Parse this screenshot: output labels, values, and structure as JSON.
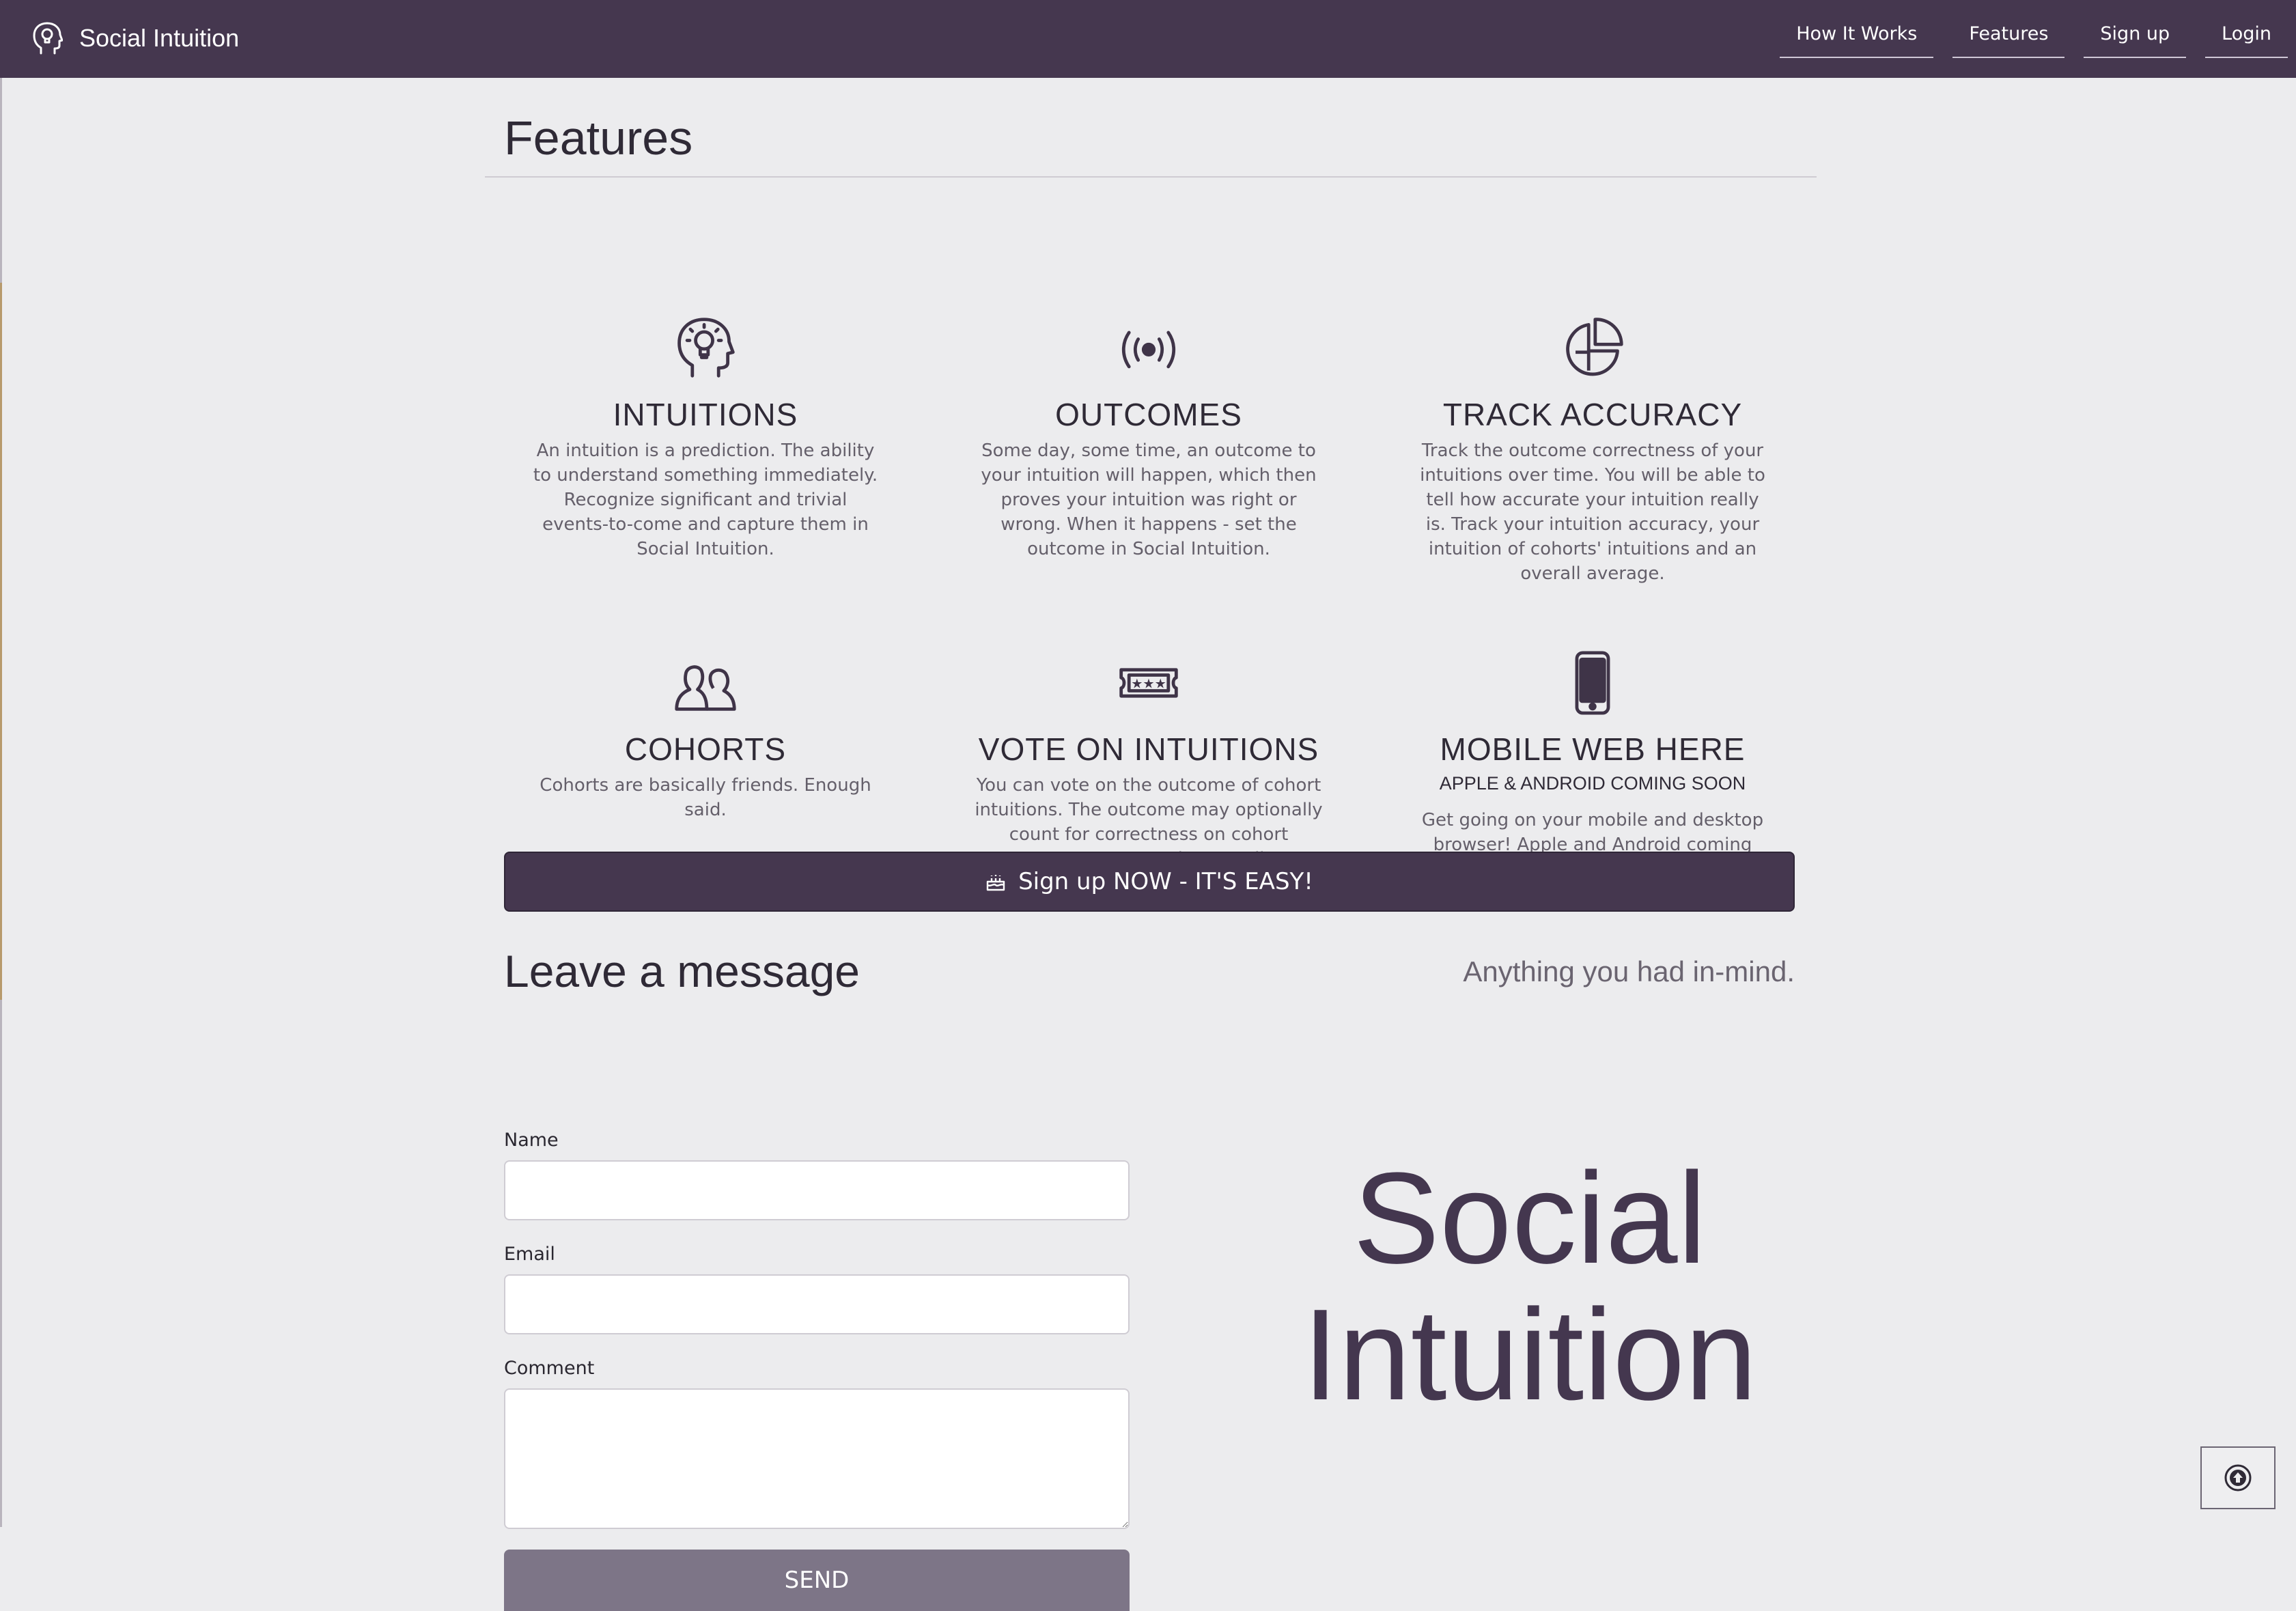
{
  "brand": {
    "name": "Social Intuition",
    "icon": "head-lightbulb-icon"
  },
  "nav": [
    {
      "label": "How It Works"
    },
    {
      "label": "Features"
    },
    {
      "label": "Sign up"
    },
    {
      "label": "Login"
    }
  ],
  "features": {
    "title": "Features",
    "items": [
      {
        "icon": "head-lightbulb-icon",
        "title": "INTUITIONS",
        "subtitle": "",
        "text": "An intuition is a prediction. The ability to understand something immediately. Recognize significant and trivial events-to-come and capture them in Social Intuition."
      },
      {
        "icon": "broadcast-icon",
        "title": "OUTCOMES",
        "subtitle": "",
        "text": "Some day, some time, an outcome to your intuition will happen, which then proves your intuition was right or wrong. When it happens - set the outcome in Social Intuition."
      },
      {
        "icon": "pie-chart-icon",
        "title": "TRACK ACCURACY",
        "subtitle": "",
        "text": "Track the outcome correctness of your intuitions over time. You will be able to tell how accurate your intuition really is. Track your intuition accuracy, your intuition of cohorts' intuitions and an overall average."
      },
      {
        "icon": "users-icon",
        "title": "COHORTS",
        "subtitle": "",
        "text": "Cohorts are basically friends. Enough said."
      },
      {
        "icon": "ticket-stars-icon",
        "title": "VOTE ON INTUITIONS",
        "subtitle": "",
        "text": "You can vote on the outcome of cohort intuitions. The outcome may optionally count for correctness on cohort accuracy. You may also contribute possible outcomes for cohort intuitions."
      },
      {
        "icon": "mobile-phone-icon",
        "title": "MOBILE WEB HERE",
        "subtitle": "APPLE & ANDROID COMING SOON",
        "text": "Get going on your mobile and desktop browser! Apple and Android coming soon."
      }
    ]
  },
  "cta": {
    "label": "Sign up NOW - IT'S EASY!",
    "icon": "birthday-cake-icon"
  },
  "message": {
    "title": "Leave a message",
    "subtitle": "Anything you had in-mind.",
    "fields": {
      "name_label": "Name",
      "name_value": "",
      "email_label": "Email",
      "email_value": "",
      "comment_label": "Comment",
      "comment_value": ""
    },
    "send_label": "SEND"
  },
  "big_brand": {
    "line1": "Social",
    "line2": "Intuition"
  },
  "scroll_top": {
    "icon": "arrow-up-circle-icon"
  },
  "colors": {
    "primary": "#45374f",
    "background": "#ececee",
    "button_muted": "#7d7587"
  }
}
